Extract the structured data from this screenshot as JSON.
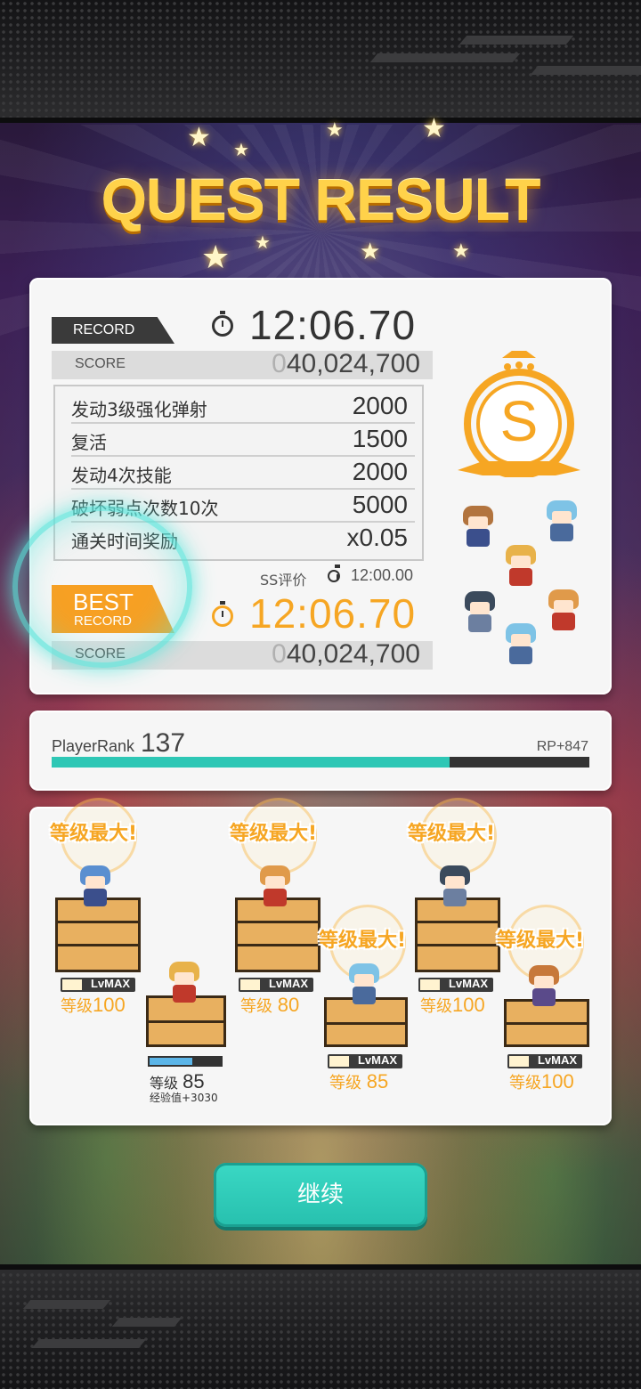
{
  "title": "QUEST RESULT",
  "record": {
    "tag": "RECORD",
    "time": "12:06.70",
    "score_label": "SCORE",
    "score_dim": "0",
    "score_value": "40,024,700"
  },
  "bonuses": [
    {
      "name": "发动3级强化弹射",
      "value": "2000"
    },
    {
      "name": "复活",
      "value": "1500"
    },
    {
      "name": "发动4次技能",
      "value": "2000"
    },
    {
      "name": "破坏弱点次数10次",
      "value": "5000"
    },
    {
      "name": "通关时间奖励",
      "value": "x0.05"
    }
  ],
  "ss_rating": {
    "label": "SS评价",
    "time": "12:00.00"
  },
  "best": {
    "tag_line1": "BEST",
    "tag_line2": "RECORD",
    "time": "12:06.70",
    "score_label": "SCORE",
    "score_dim": "0",
    "score_value": "40,024,700"
  },
  "rank": {
    "letter": "S"
  },
  "player": {
    "label": "PlayerRank",
    "rank": "137",
    "rp": "RP+847",
    "progress": 0.74
  },
  "party": [
    {
      "max_label": "等级最大!",
      "lv_label": "等级",
      "level": "100",
      "badge": "LvMAX",
      "hair": "#5a8fd0",
      "body": "#3b4f8c"
    },
    {
      "lv_label": "等级",
      "level": "85",
      "exp": "经验值+3030",
      "exp_progress": 0.6,
      "hair": "#e8b24a",
      "body": "#c0392b"
    },
    {
      "max_label": "等级最大!",
      "lv_label": "等级",
      "level": "80",
      "badge": "LvMAX",
      "hair": "#e09a4a",
      "body": "#c0392b"
    },
    {
      "max_label": "等级最大!",
      "lv_label": "等级",
      "level": "85",
      "badge": "LvMAX",
      "hair": "#7ec3e6",
      "body": "#4a6a9c"
    },
    {
      "max_label": "等级最大!",
      "lv_label": "等级",
      "level": "100",
      "badge": "LvMAX",
      "hair": "#3b4a5c",
      "body": "#6c7fa0"
    },
    {
      "max_label": "等级最大!",
      "lv_label": "等级",
      "level": "100",
      "badge": "LvMAX",
      "hair": "#c7783a",
      "body": "#5a4a8a"
    }
  ],
  "continue_label": "继续",
  "colors": {
    "accent": "#f6a623",
    "teal": "#2ec7b5",
    "gold": "#ffd24a"
  }
}
